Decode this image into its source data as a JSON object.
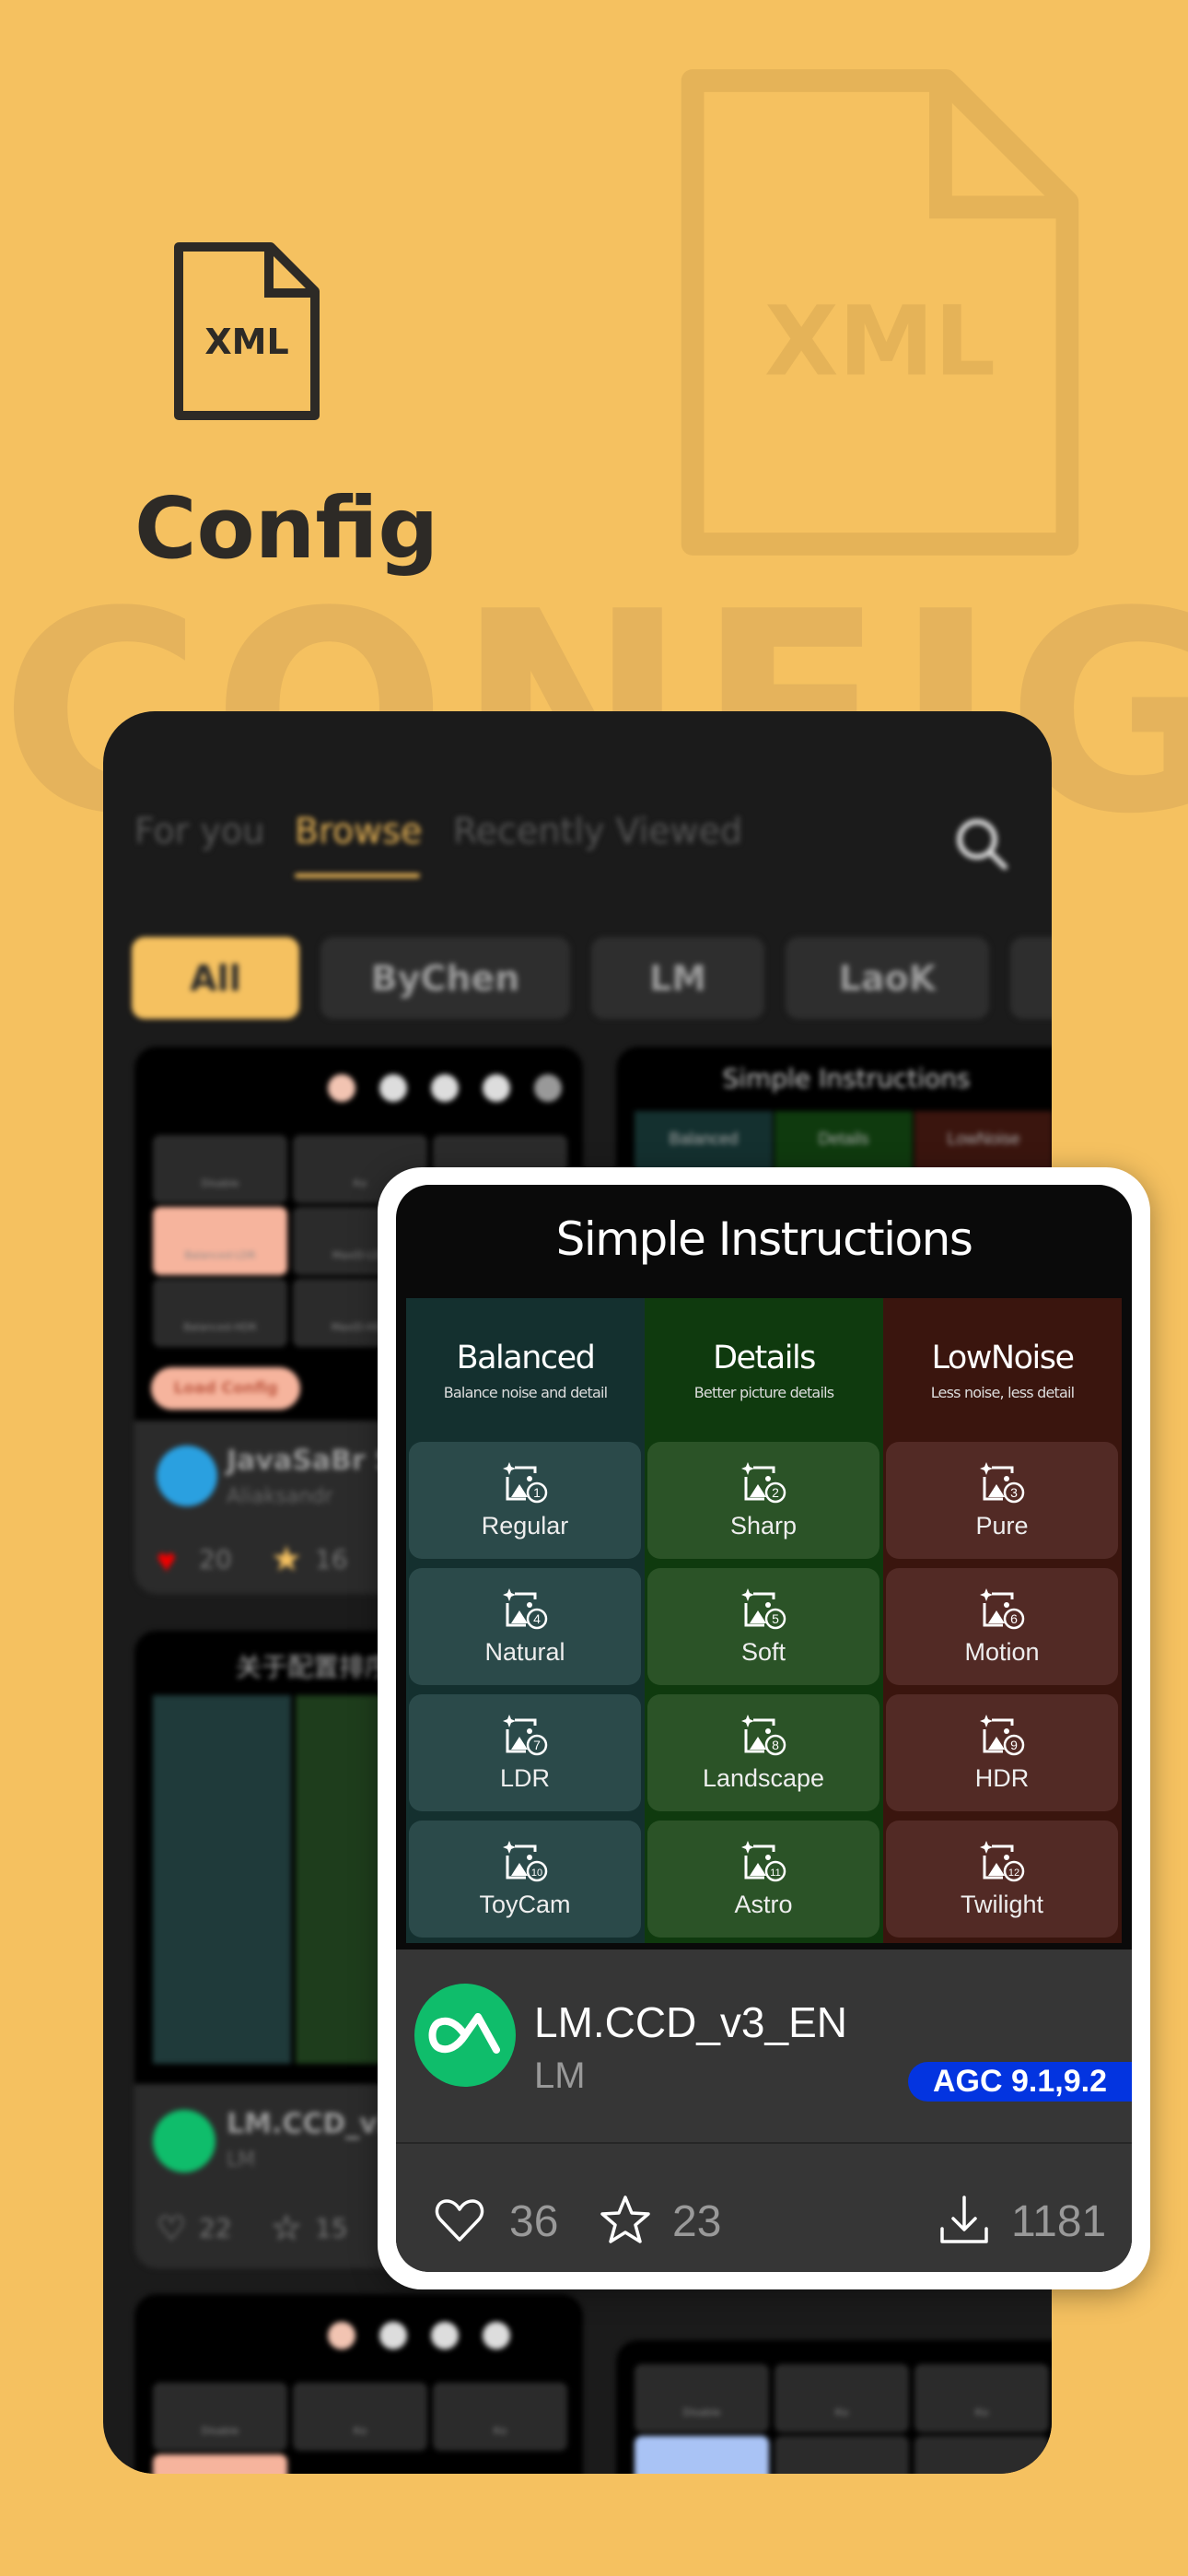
{
  "hero": {
    "watermark_text": "CONFIG",
    "icon_label": "XML",
    "title": "Config"
  },
  "colors": {
    "background": "#f5c160",
    "accent": "#e9b556",
    "badge": "#0334e0",
    "balanced": "#2b4a4a",
    "details": "#2b5327",
    "lownoise": "#522a25"
  },
  "app": {
    "tabs": [
      {
        "label": "For you"
      },
      {
        "label": "Browse",
        "active": true
      },
      {
        "label": "Recently Viewed"
      }
    ],
    "chips": [
      {
        "label": "All",
        "active": true
      },
      {
        "label": "ByChen"
      },
      {
        "label": "LM"
      },
      {
        "label": "LaoK"
      }
    ],
    "card1": {
      "tiles": [
        "Disable",
        "Ко",
        "",
        "Balanced-LDR",
        "MaxiD-LDR",
        "",
        "Balanced-HDR",
        "MaxiD-HDR",
        ""
      ],
      "load_button": "Load Config",
      "name": "JavaSaBr S2",
      "author": "Aliaksandr",
      "likes": "20",
      "stars": "16"
    },
    "card2": {
      "title": "关于配置排序作",
      "name": "LM.CCD_v3_",
      "author": "LM",
      "likes": "22",
      "stars": "15"
    },
    "card3": {
      "tiles": [
        "Disable",
        "Ко",
        "Ко"
      ]
    },
    "right_card": {
      "title": "Simple Instructions",
      "cols": [
        "Balanced",
        "Details",
        "LowNoise"
      ]
    },
    "right_card_bottom": {
      "tiles": [
        "Disable",
        "Ко",
        "Ко"
      ]
    }
  },
  "config_card": {
    "title": "Simple Instructions",
    "columns": [
      {
        "name": "Balanced",
        "subtitle": "Balance noise and detail",
        "modes": [
          {
            "num": "1",
            "label": "Regular"
          },
          {
            "num": "4",
            "label": "Natural"
          },
          {
            "num": "7",
            "label": "LDR"
          },
          {
            "num": "10",
            "label": "ToyCam"
          }
        ]
      },
      {
        "name": "Details",
        "subtitle": "Better picture details",
        "modes": [
          {
            "num": "2",
            "label": "Sharp"
          },
          {
            "num": "5",
            "label": "Soft"
          },
          {
            "num": "8",
            "label": "Landscape"
          },
          {
            "num": "11",
            "label": "Astro"
          }
        ]
      },
      {
        "name": "LowNoise",
        "subtitle": "Less noise, less detail",
        "modes": [
          {
            "num": "3",
            "label": "Pure"
          },
          {
            "num": "6",
            "label": "Motion"
          },
          {
            "num": "9",
            "label": "HDR"
          },
          {
            "num": "12",
            "label": "Twilight"
          }
        ]
      }
    ],
    "name": "LM.CCD_v3_EN",
    "author": "LM",
    "badge": "AGC 9.1,9.2",
    "likes": "36",
    "stars": "23",
    "downloads": "1181"
  }
}
